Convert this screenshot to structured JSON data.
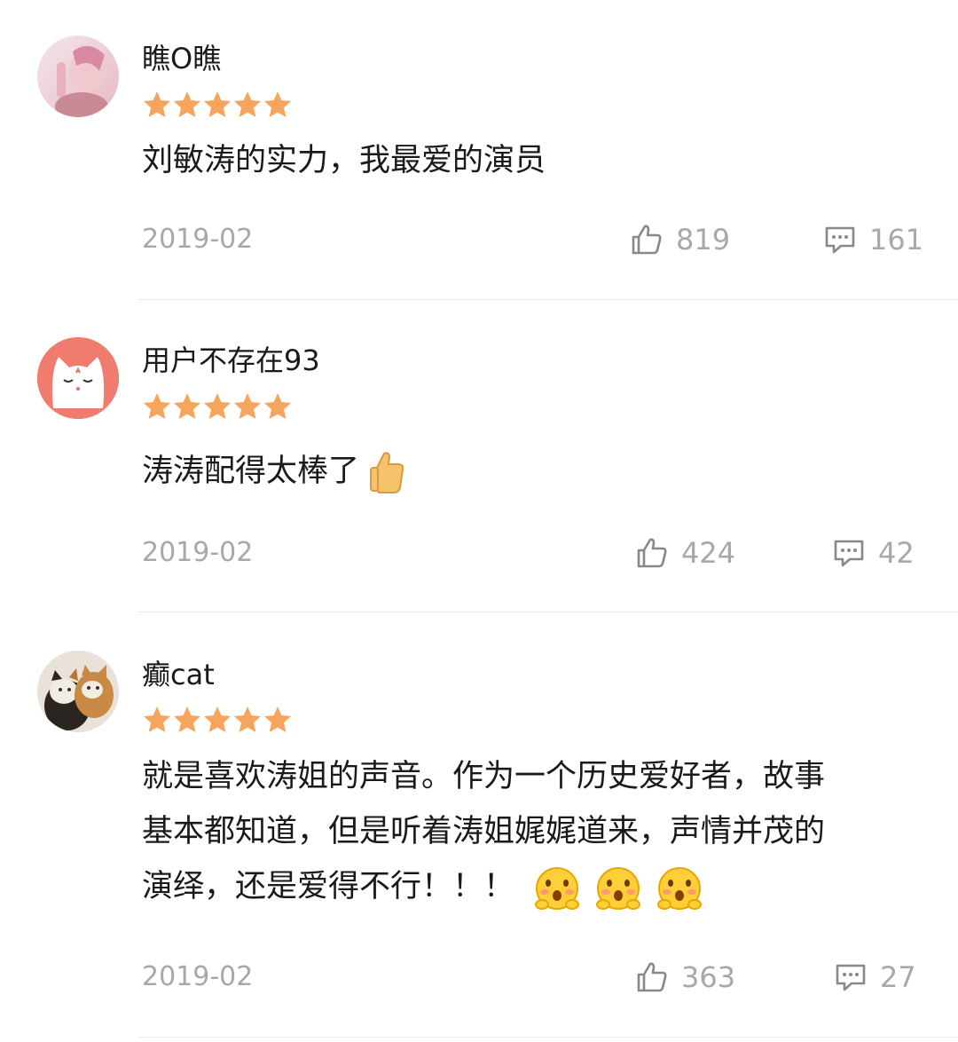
{
  "comments": [
    {
      "username": "瞧O瞧",
      "rating": 5,
      "text": "刘敏涛的实力，我最爱的演员",
      "date": "2019-02",
      "likes": "819",
      "replies": "161",
      "avatar_icon": "avatar-pink-photo"
    },
    {
      "username": "用户不存在93",
      "rating": 5,
      "text": "涛涛配得太棒了",
      "text_emoji": "thumbs-up-emoji",
      "date": "2019-02",
      "likes": "424",
      "replies": "42",
      "avatar_icon": "avatar-white-cat"
    },
    {
      "username": "癫cat",
      "rating": 5,
      "text_line1": "就是喜欢涛姐的声音。作为一个历史爱好者，故事",
      "text_line2": "基本都知道，但是听着涛姐娓娓道来，声情并茂的",
      "text_line3": "演绎，还是爱得不行！！！",
      "text_emoji": "blushing-face-emoji x3",
      "date": "2019-02",
      "likes": "363",
      "replies": "27",
      "avatar_icon": "avatar-cats-photo"
    }
  ],
  "colors": {
    "star": "#f7a55c",
    "meta_text": "#a8a8a8",
    "divider": "#ececec",
    "avatar_coral": "#ef7c6e"
  }
}
